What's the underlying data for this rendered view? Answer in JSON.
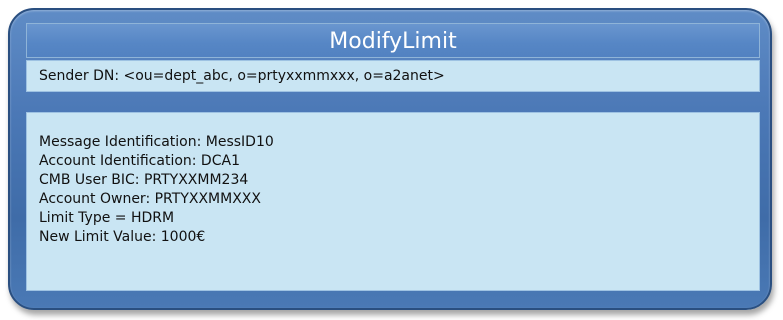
{
  "title": "ModifyLimit",
  "sender": "Sender DN: <ou=dept_abc, o=prtyxxmmxxx, o=a2anet>",
  "details": [
    "Message Identification: MessID10",
    "Account Identification: DCA1",
    "CMB User BIC: PRTYXXMM234",
    "Account Owner: PRTYXXMMXXX",
    "Limit Type = HDRM",
    "New Limit Value: 1000€"
  ]
}
